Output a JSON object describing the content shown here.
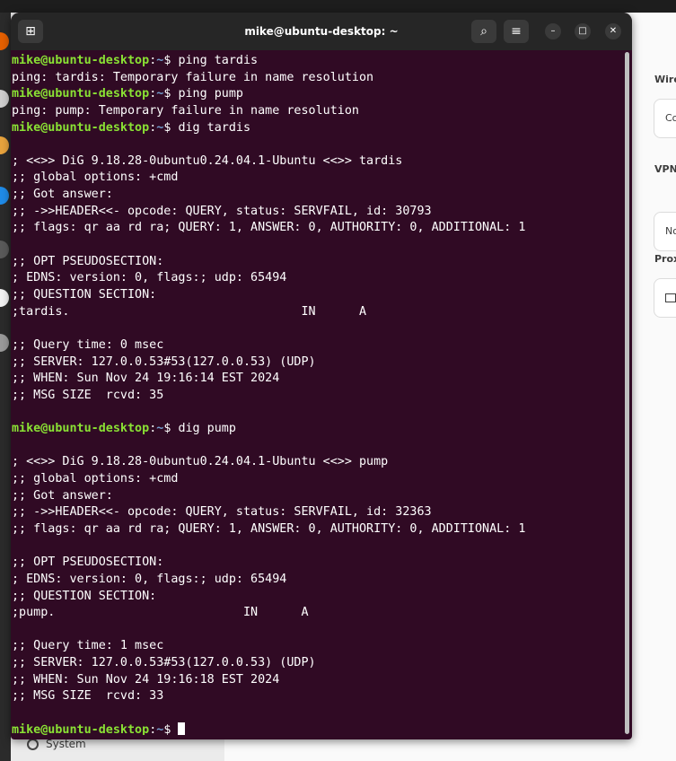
{
  "window": {
    "title": "mike@ubuntu-desktop: ~",
    "icons": {
      "new_tab": "new-tab-icon",
      "search": "search-icon",
      "menu": "hamburger-menu-icon",
      "minimize": "minimize-icon",
      "maximize": "maximize-icon",
      "close": "close-icon"
    }
  },
  "prompt": {
    "user": "mike@ubuntu-desktop",
    "sep": ":",
    "path": "~",
    "symbol": "$"
  },
  "terminal": {
    "lines": [
      {
        "type": "prompt",
        "cmd": "ping tardis"
      },
      {
        "type": "out",
        "text": "ping: tardis: Temporary failure in name resolution"
      },
      {
        "type": "prompt",
        "cmd": "ping pump"
      },
      {
        "type": "out",
        "text": "ping: pump: Temporary failure in name resolution"
      },
      {
        "type": "prompt",
        "cmd": "dig tardis"
      },
      {
        "type": "out",
        "text": ""
      },
      {
        "type": "out",
        "text": "; <<>> DiG 9.18.28-0ubuntu0.24.04.1-Ubuntu <<>> tardis"
      },
      {
        "type": "out",
        "text": ";; global options: +cmd"
      },
      {
        "type": "out",
        "text": ";; Got answer:"
      },
      {
        "type": "out",
        "text": ";; ->>HEADER<<- opcode: QUERY, status: SERVFAIL, id: 30793"
      },
      {
        "type": "out",
        "text": ";; flags: qr aa rd ra; QUERY: 1, ANSWER: 0, AUTHORITY: 0, ADDITIONAL: 1"
      },
      {
        "type": "out",
        "text": ""
      },
      {
        "type": "out",
        "text": ";; OPT PSEUDOSECTION:"
      },
      {
        "type": "out",
        "text": "; EDNS: version: 0, flags:; udp: 65494"
      },
      {
        "type": "out",
        "text": ";; QUESTION SECTION:"
      },
      {
        "type": "out",
        "text": ";tardis.                                IN      A"
      },
      {
        "type": "out",
        "text": ""
      },
      {
        "type": "out",
        "text": ";; Query time: 0 msec"
      },
      {
        "type": "out",
        "text": ";; SERVER: 127.0.0.53#53(127.0.0.53) (UDP)"
      },
      {
        "type": "out",
        "text": ";; WHEN: Sun Nov 24 19:16:14 EST 2024"
      },
      {
        "type": "out",
        "text": ";; MSG SIZE  rcvd: 35"
      },
      {
        "type": "out",
        "text": ""
      },
      {
        "type": "prompt",
        "cmd": "dig pump"
      },
      {
        "type": "out",
        "text": ""
      },
      {
        "type": "out",
        "text": "; <<>> DiG 9.18.28-0ubuntu0.24.04.1-Ubuntu <<>> pump"
      },
      {
        "type": "out",
        "text": ";; global options: +cmd"
      },
      {
        "type": "out",
        "text": ";; Got answer:"
      },
      {
        "type": "out",
        "text": ";; ->>HEADER<<- opcode: QUERY, status: SERVFAIL, id: 32363"
      },
      {
        "type": "out",
        "text": ";; flags: qr aa rd ra; QUERY: 1, ANSWER: 0, AUTHORITY: 0, ADDITIONAL: 1"
      },
      {
        "type": "out",
        "text": ""
      },
      {
        "type": "out",
        "text": ";; OPT PSEUDOSECTION:"
      },
      {
        "type": "out",
        "text": "; EDNS: version: 0, flags:; udp: 65494"
      },
      {
        "type": "out",
        "text": ";; QUESTION SECTION:"
      },
      {
        "type": "out",
        "text": ";pump.                          IN      A"
      },
      {
        "type": "out",
        "text": ""
      },
      {
        "type": "out",
        "text": ";; Query time: 1 msec"
      },
      {
        "type": "out",
        "text": ";; SERVER: 127.0.0.53#53(127.0.0.53) (UDP)"
      },
      {
        "type": "out",
        "text": ";; WHEN: Sun Nov 24 19:16:18 EST 2024"
      },
      {
        "type": "out",
        "text": ";; MSG SIZE  rcvd: 33"
      },
      {
        "type": "out",
        "text": ""
      },
      {
        "type": "prompt",
        "cmd": "",
        "cursor": true
      }
    ]
  },
  "settings": {
    "sidebar_item": "System",
    "sidebar_icon": "gear-icon",
    "headings": [
      "Wire",
      "VPN",
      "Prox"
    ],
    "cards": [
      "Co",
      "No",
      ""
    ]
  },
  "colors": {
    "terminal_bg": "#300a24",
    "prompt_user": "#8ae234",
    "prompt_path": "#729fcf",
    "titlebar_bg": "#262626"
  }
}
